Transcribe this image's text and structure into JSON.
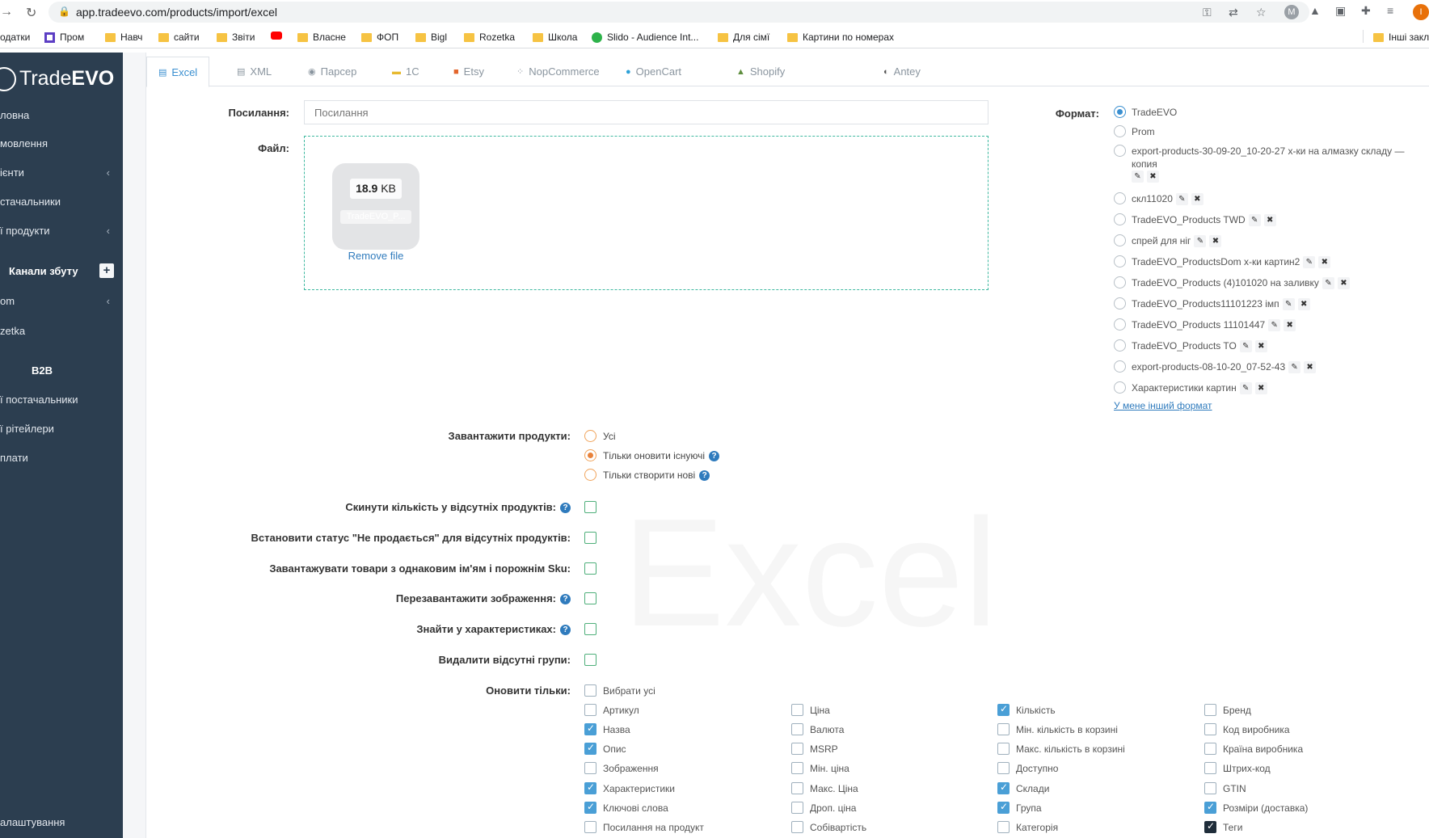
{
  "browser": {
    "url": "app.tradeevo.com/products/import/excel",
    "bookmarks": [
      {
        "label": "одатки",
        "icon": "none"
      },
      {
        "label": "Пром",
        "icon": "purple"
      },
      {
        "label": "Навч",
        "icon": "folder"
      },
      {
        "label": "сайти",
        "icon": "folder"
      },
      {
        "label": "Звіти",
        "icon": "folder"
      },
      {
        "label": "",
        "icon": "youtube"
      },
      {
        "label": "Власне",
        "icon": "folder"
      },
      {
        "label": "ФОП",
        "icon": "folder"
      },
      {
        "label": "Bigl",
        "icon": "folder"
      },
      {
        "label": "Rozetka",
        "icon": "folder"
      },
      {
        "label": "Школа",
        "icon": "folder"
      },
      {
        "label": "Slido - Audience Int...",
        "icon": "slido"
      },
      {
        "label": "Для сімї",
        "icon": "folder"
      },
      {
        "label": "Картини по номерах",
        "icon": "folder"
      },
      {
        "label": "Інші закл",
        "icon": "folder"
      }
    ]
  },
  "sidebar": {
    "logo_light": "Trade",
    "logo_bold": "EVO",
    "items": [
      {
        "label": "ловна",
        "chevron": false
      },
      {
        "label": "мовлення",
        "chevron": false
      },
      {
        "label": "ієнти",
        "chevron": true
      },
      {
        "label": "стачальники",
        "chevron": false
      },
      {
        "label": "ї продукти",
        "chevron": true
      }
    ],
    "channels_head": "Канали збуту",
    "channels": [
      {
        "label": "om",
        "chevron": true
      },
      {
        "label": "zetka",
        "chevron": false
      }
    ],
    "b2b_head": "B2B",
    "b2b": [
      {
        "label": "ї постачальники"
      },
      {
        "label": "ї рітейлери"
      },
      {
        "label": "плати"
      }
    ],
    "settings": "алаштування"
  },
  "tabs": [
    {
      "label": "Excel",
      "icon": "excel-icon",
      "active": true
    },
    {
      "label": "XML",
      "icon": "xml-icon",
      "active": false
    },
    {
      "label": "Парсер",
      "icon": "eye-icon",
      "active": false
    },
    {
      "label": "1С",
      "icon": "1c-icon",
      "active": false
    },
    {
      "label": "Etsy",
      "icon": "etsy-icon",
      "active": false
    },
    {
      "label": "NopCommerce",
      "icon": "nop-icon",
      "active": false
    },
    {
      "label": "OpenCart",
      "icon": "opencart-icon",
      "active": false
    },
    {
      "label": "Shopify",
      "icon": "shopify-icon",
      "active": false
    },
    {
      "label": "Antey",
      "icon": "antey-icon",
      "active": false
    }
  ],
  "form": {
    "link_label": "Посилання:",
    "link_placeholder": "Посилання",
    "file_label": "Файл:",
    "file_size_num": "18.9",
    "file_size_unit": "KB",
    "file_name": "TradeEVO_P...",
    "remove_file": "Remove file",
    "format_label": "Формат:",
    "formats": [
      {
        "label": "TradeEVO",
        "selected": true,
        "actions": false
      },
      {
        "label": "Prom",
        "selected": false,
        "actions": false
      },
      {
        "label": "export-products-30-09-20_10-20-27 х-ки на алмазку складу —",
        "label2": "копия",
        "selected": false,
        "actions": true
      },
      {
        "label": "скл11020",
        "selected": false,
        "actions": true
      },
      {
        "label": "TradeEVO_Products TWD",
        "selected": false,
        "actions": true
      },
      {
        "label": "спрей для ніг",
        "selected": false,
        "actions": true
      },
      {
        "label": "TradeEVO_ProductsDom х-ки картин2",
        "selected": false,
        "actions": true
      },
      {
        "label": "TradeEVO_Products (4)101020 на заливку",
        "selected": false,
        "actions": true
      },
      {
        "label": "TradeEVO_Products11101223 імп",
        "selected": false,
        "actions": true
      },
      {
        "label": "TradeEVO_Products 11101447",
        "selected": false,
        "actions": true
      },
      {
        "label": "TradeEVO_Products TO",
        "selected": false,
        "actions": true
      },
      {
        "label": "export-products-08-10-20_07-52-43",
        "selected": false,
        "actions": true
      },
      {
        "label": "Характеристики картин",
        "selected": false,
        "actions": true
      }
    ],
    "other_format": "У мене інший формат",
    "upload_label": "Завантажити продукти:",
    "upload_options": [
      {
        "label": "Усі",
        "selected": false,
        "help": false
      },
      {
        "label": "Тільки оновити існуючі",
        "selected": true,
        "help": true
      },
      {
        "label": "Тільки створити нові",
        "selected": false,
        "help": true
      }
    ],
    "checks": [
      {
        "label": "Скинути кількість у відсутніх продуктів:",
        "help": true
      },
      {
        "label": "Встановити статус \"Не продається\" для відсутніх продуктів:",
        "help": false
      },
      {
        "label": "Завантажувати товари з однаковим ім'ям і порожнім Sku:",
        "help": false
      },
      {
        "label": "Перезавантажити зображення:",
        "help": true
      },
      {
        "label": "Знайти у характеристиках:",
        "help": true
      },
      {
        "label": "Видалити відсутні групи:",
        "help": false
      }
    ],
    "update_only_label": "Оновити тільки:",
    "select_all": "Вибрати усі",
    "fields_col1": [
      {
        "label": "Артикул",
        "checked": false
      },
      {
        "label": "Назва",
        "checked": true
      },
      {
        "label": "Опис",
        "checked": true
      },
      {
        "label": "Зображення",
        "checked": false
      },
      {
        "label": "Характеристики",
        "checked": true
      },
      {
        "label": "Ключові слова",
        "checked": true
      },
      {
        "label": "Посилання на продукт",
        "checked": false
      }
    ],
    "fields_col2": [
      {
        "label": "Ціна",
        "checked": false
      },
      {
        "label": "Валюта",
        "checked": false
      },
      {
        "label": "MSRP",
        "checked": false
      },
      {
        "label": "Мін. ціна",
        "checked": false
      },
      {
        "label": "Макс. Ціна",
        "checked": false
      },
      {
        "label": "Дроп. ціна",
        "checked": false
      },
      {
        "label": "Собівартість",
        "checked": false
      }
    ],
    "fields_col3": [
      {
        "label": "Кількість",
        "checked": true
      },
      {
        "label": "Мін. кількість в корзині",
        "checked": false
      },
      {
        "label": "Макс. кількість в корзині",
        "checked": false
      },
      {
        "label": "Доступно",
        "checked": false
      },
      {
        "label": "Склади",
        "checked": true
      },
      {
        "label": "Група",
        "checked": true
      },
      {
        "label": "Категорія",
        "checked": false
      }
    ],
    "fields_col4": [
      {
        "label": "Бренд",
        "checked": false
      },
      {
        "label": "Код виробника",
        "checked": false
      },
      {
        "label": "Країна виробника",
        "checked": false
      },
      {
        "label": "Штрих-код",
        "checked": false
      },
      {
        "label": "GTIN",
        "checked": false
      },
      {
        "label": "Розміри (доставка)",
        "checked": true
      },
      {
        "label": "Теги",
        "checked": true
      }
    ]
  },
  "watermark": "Excel"
}
